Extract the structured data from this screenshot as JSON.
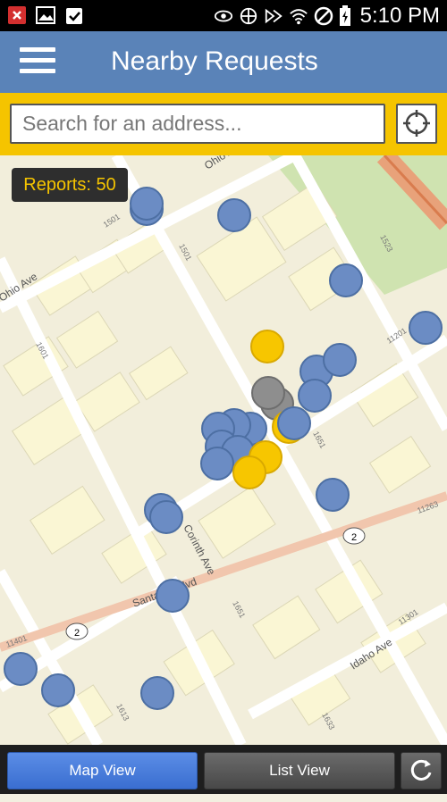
{
  "status_bar": {
    "time": "5:10 PM",
    "left_icons": [
      "error-icon",
      "image-icon",
      "clipboard-icon"
    ],
    "right_icons": [
      "eye-icon",
      "data-icon",
      "mute-icon",
      "wifi-icon",
      "no-signal-icon",
      "battery-charging-icon"
    ]
  },
  "header": {
    "title": "Nearby Requests",
    "menu_icon": "menu-icon"
  },
  "search": {
    "placeholder": "Search for an address...",
    "locate_icon": "crosshair-icon"
  },
  "map": {
    "reports_label": "Reports: 50",
    "street_labels": [
      "Ohio Ave",
      "Ohio Ave",
      "Santa Fe Blvd",
      "Corinth Ave",
      "Idaho Ave",
      "2",
      "2"
    ],
    "address_numbers": [
      "1501",
      "1501",
      "1523",
      "11201",
      "1601",
      "11263",
      "1651",
      "11401",
      "1651",
      "1613",
      "11301",
      "1633"
    ],
    "colors": {
      "report_blue": "#6b8cc4",
      "report_yellow": "#f7c600",
      "report_gray": "#8e8e8e",
      "block": "#faf7dc",
      "street": "#ffffff",
      "boulevard": "#f1c6ad"
    }
  },
  "bottom_bar": {
    "map_view": "Map View",
    "list_view": "List View",
    "refresh_icon": "refresh-icon"
  }
}
